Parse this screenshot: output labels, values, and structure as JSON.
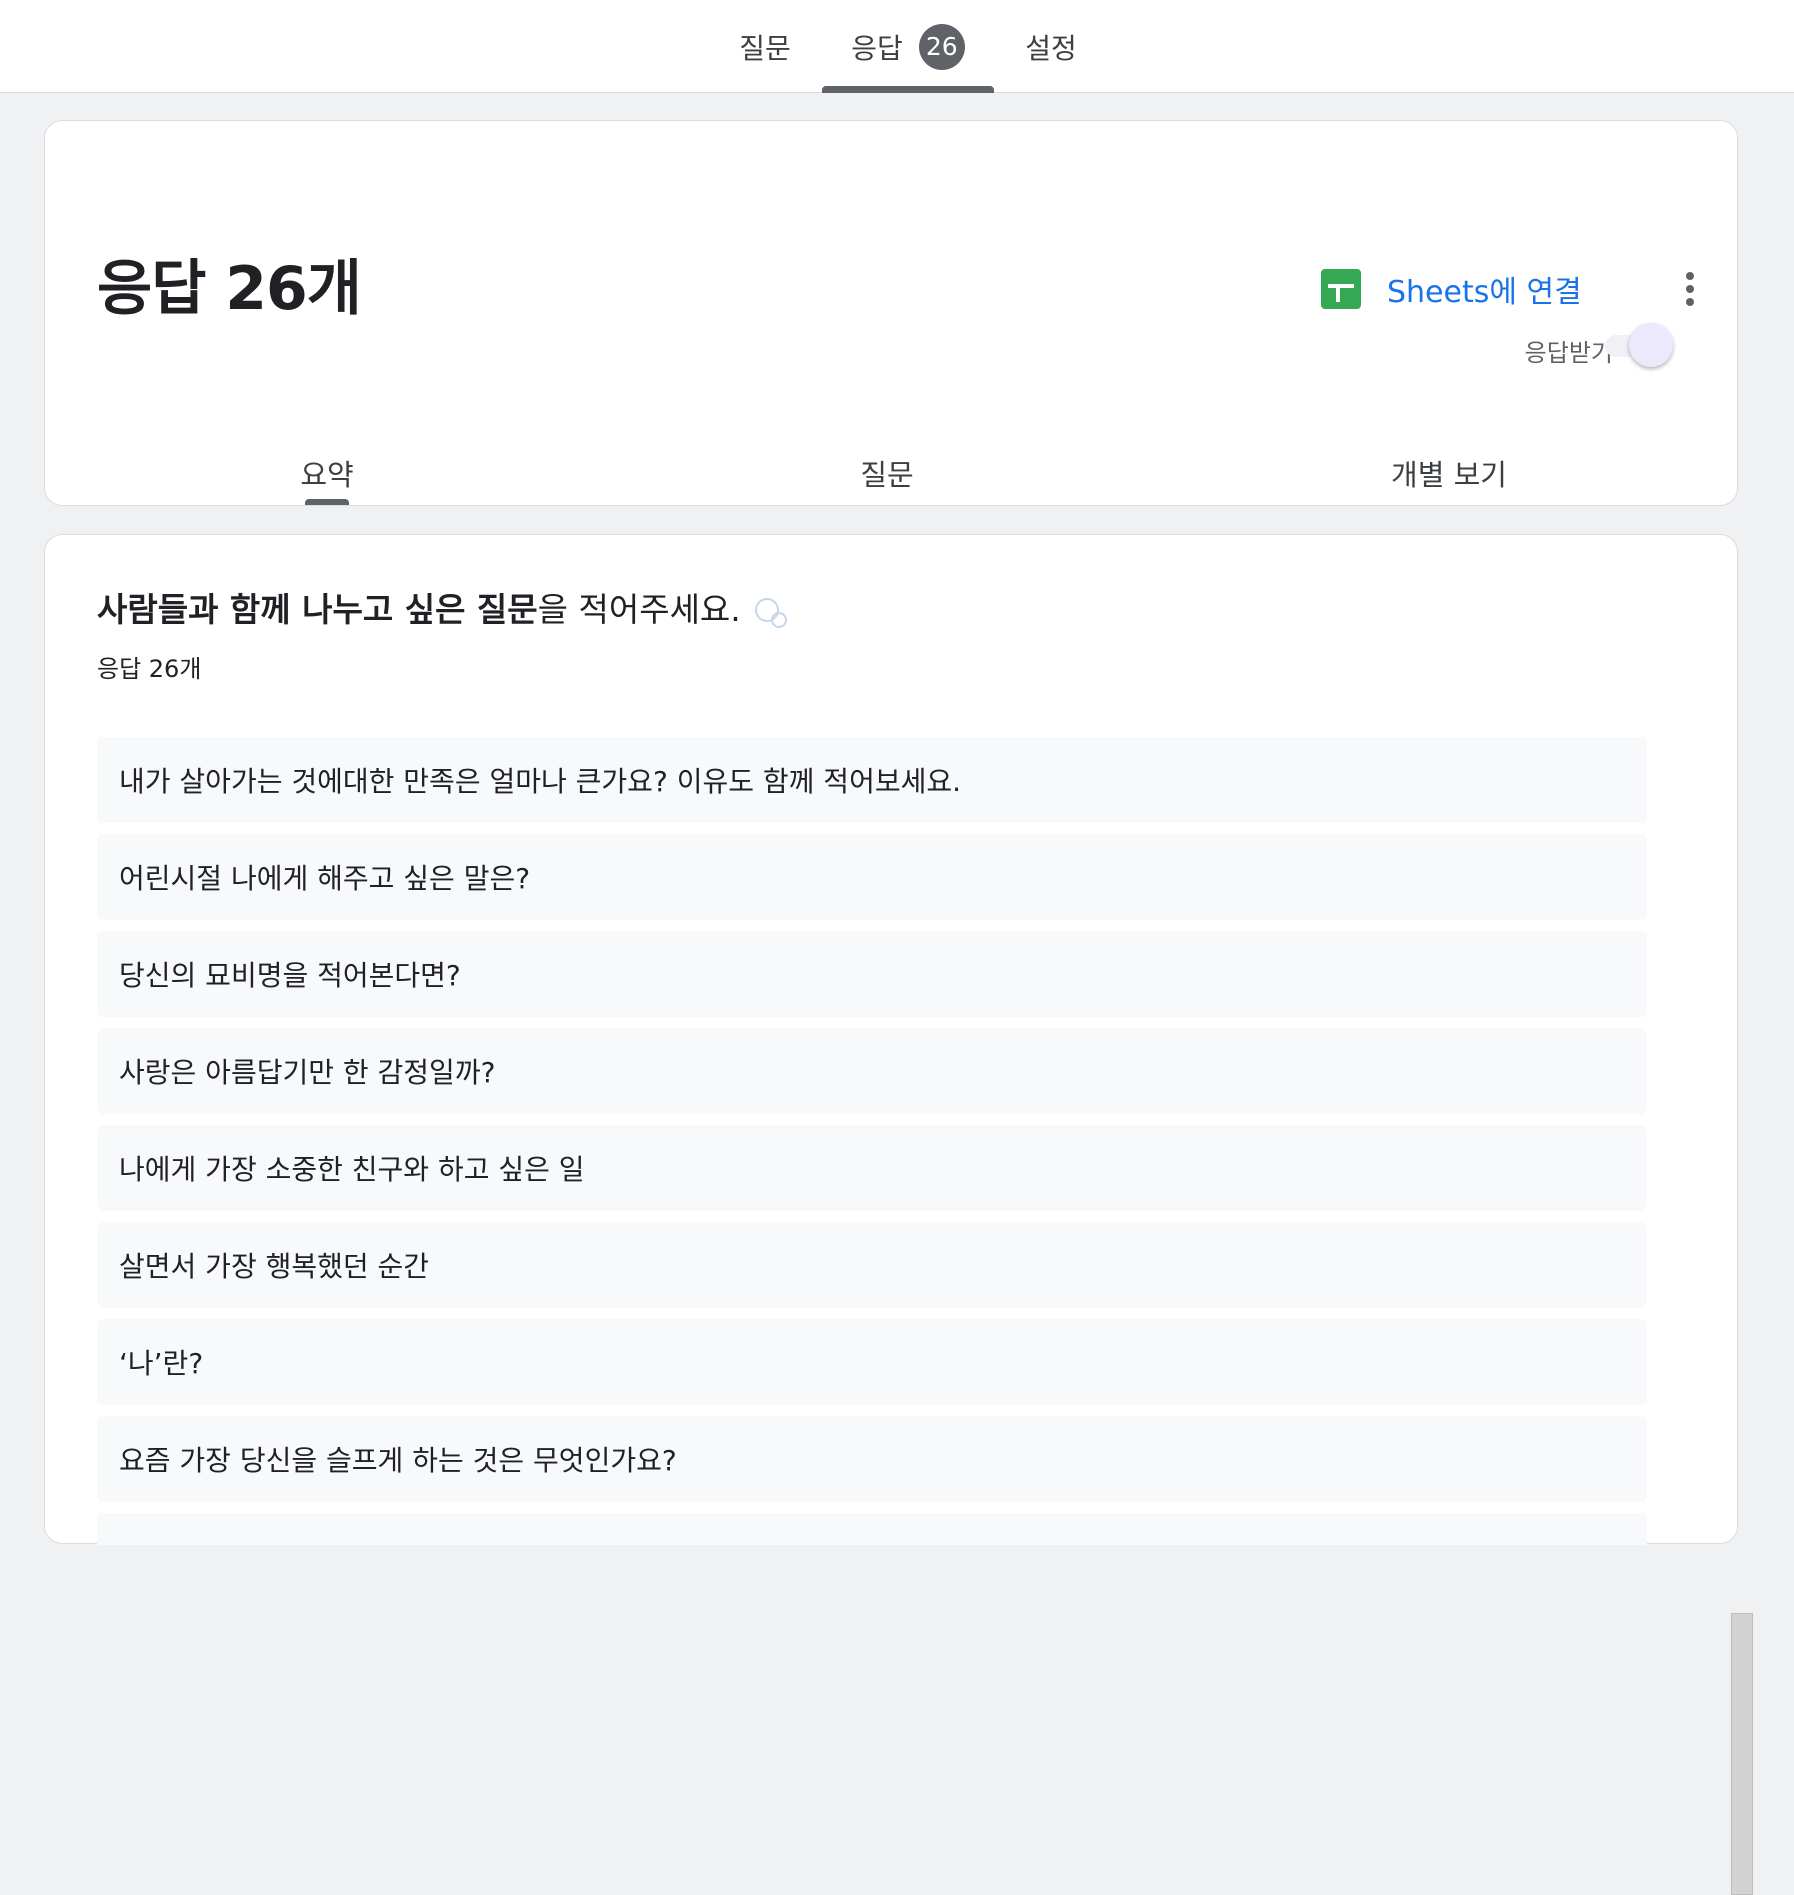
{
  "top_tabs": {
    "questions": "질문",
    "responses": "응답",
    "responses_count": "26",
    "settings": "설정"
  },
  "header": {
    "title": "응답 26개",
    "sheets_label": "Sheets에 연결",
    "accepting_label": "응답받기",
    "accepting_on": true
  },
  "sub_tabs": {
    "summary": "요약",
    "question": "질문",
    "individual": "개별 보기"
  },
  "question": {
    "title_bold": "사람들과 함께 나누고 싶은 질문",
    "title_rest": "을 적어주세요.",
    "count": "응답 26개"
  },
  "answers": [
    "내가 살아가는 것에대한 만족은 얼마나 큰가요? 이유도 함께 적어보세요.",
    "어린시절 나에게 해주고 싶은 말은?",
    "당신의 묘비명을 적어본다면?",
    "사랑은 아름답기만 한 감정일까?",
    "나에게 가장 소중한 친구와 하고 싶은 일",
    "살면서 가장 행복했던 순간",
    "‘나’란?",
    "요즘 가장 당신을 슬프게 하는 것은 무엇인가요?",
    ""
  ],
  "colors": {
    "accent": "#5f6368",
    "link": "#1a73e8",
    "sheets_green": "#34a853"
  },
  "icons": {
    "sheets": "sheets-icon",
    "more": "more-vert-icon",
    "bubbles": "bubbles-emoji-icon"
  }
}
